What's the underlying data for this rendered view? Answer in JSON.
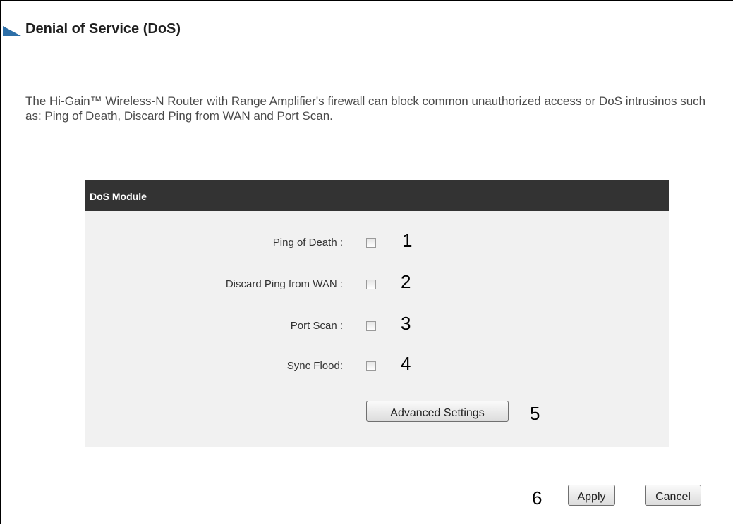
{
  "page": {
    "title": "Denial of Service (DoS)",
    "description": "The Hi-Gain™ Wireless-N Router with Range Amplifier's firewall can block common unauthorized access or DoS intrusinos such as: Ping of Death, Discard Ping from WAN and Port Scan."
  },
  "dos_module": {
    "header": "DoS Module",
    "options": [
      {
        "label": "Ping of Death :",
        "checked": false,
        "callout": "1"
      },
      {
        "label": "Discard Ping from WAN :",
        "checked": false,
        "callout": "2"
      },
      {
        "label": "Port Scan :",
        "checked": false,
        "callout": "3"
      },
      {
        "label": "Sync Flood:",
        "checked": false,
        "callout": "4"
      }
    ],
    "advanced_button": "Advanced Settings",
    "advanced_callout": "5"
  },
  "footer": {
    "callout": "6",
    "apply_label": "Apply",
    "cancel_label": "Cancel"
  },
  "colors": {
    "header_bg": "#333333",
    "panel_bg": "#f1f1f1",
    "title_marker": "#2d6fa8"
  }
}
